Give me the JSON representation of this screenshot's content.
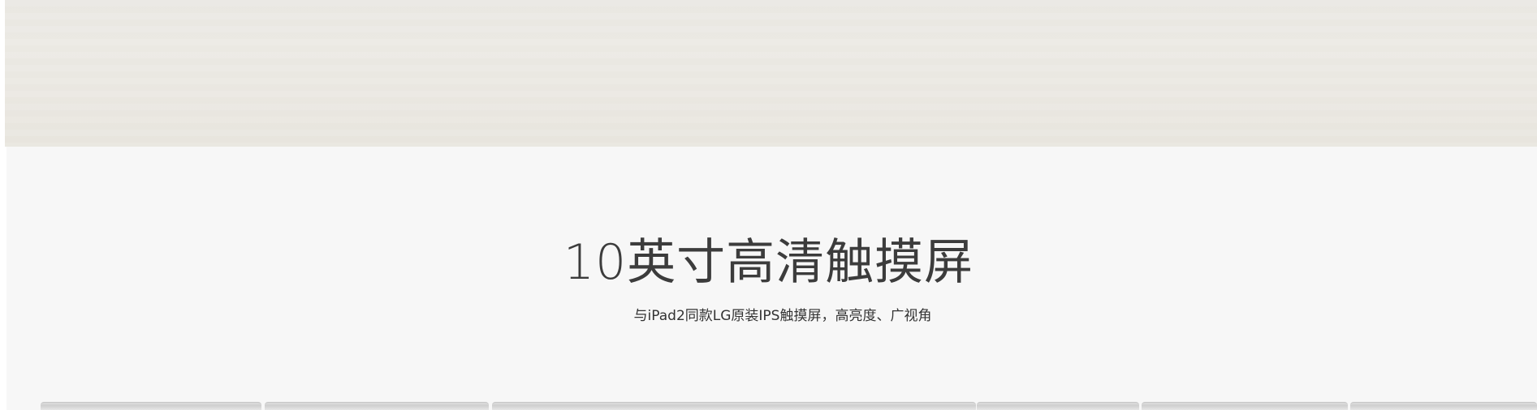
{
  "feature": {
    "title": "10英寸高清触摸屏",
    "subtitle": "与iPad2同款LG原装IPS触摸屏，高亮度、广视角"
  },
  "colors": {
    "banner": "#eae8e2",
    "section_background": "#f7f7f7",
    "title_text": "#3c3c3c",
    "subtitle_text": "#333333"
  }
}
